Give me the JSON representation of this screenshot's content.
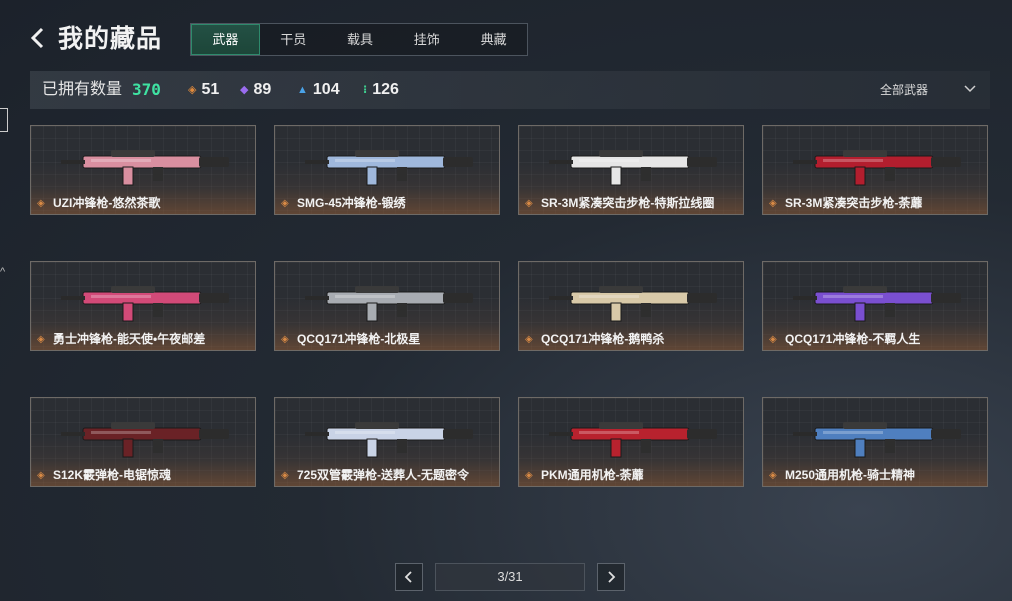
{
  "header": {
    "title": "我的藏品"
  },
  "tabs": [
    {
      "label": "武器",
      "active": true
    },
    {
      "label": "干员",
      "active": false
    },
    {
      "label": "载具",
      "active": false
    },
    {
      "label": "挂饰",
      "active": false
    },
    {
      "label": "典藏",
      "active": false
    }
  ],
  "stats": {
    "owned_label": "已拥有数量",
    "owned_count": "370",
    "tiers": [
      {
        "icon": "orange-diamond-icon",
        "color": "#e08a3c",
        "count": "51"
      },
      {
        "icon": "purple-diamond-icon",
        "color": "#9a6cf0",
        "count": "89"
      },
      {
        "icon": "blue-chevron-icon",
        "color": "#4aa3e8",
        "count": "104"
      },
      {
        "icon": "green-dots-icon",
        "color": "#3fd08f",
        "count": "126"
      }
    ],
    "filter_label": "全部武器"
  },
  "items": [
    {
      "name": "UZI冲锋枪-悠然茶歌",
      "gun_color": "#d98fa0"
    },
    {
      "name": "SMG-45冲锋枪-锻绣",
      "gun_color": "#9fb8dc"
    },
    {
      "name": "SR-3M紧凑突击步枪-特斯拉线圈",
      "gun_color": "#e6e6e6"
    },
    {
      "name": "SR-3M紧凑突击步枪-荼蘼",
      "gun_color": "#b31e2e"
    },
    {
      "name": "勇士冲锋枪-能天使•午夜邮差",
      "gun_color": "#d24a78"
    },
    {
      "name": "QCQ171冲锋枪-北极星",
      "gun_color": "#a8acb2"
    },
    {
      "name": "QCQ171冲锋枪-鹅鸭杀",
      "gun_color": "#d8c9a8"
    },
    {
      "name": "QCQ171冲锋枪-不羁人生",
      "gun_color": "#7a4fd0"
    },
    {
      "name": "S12K霰弹枪-电锯惊魂",
      "gun_color": "#6a2226"
    },
    {
      "name": "725双管霰弹枪-送葬人-无题密令",
      "gun_color": "#c9d3e6"
    },
    {
      "name": "PKM通用机枪-荼蘼",
      "gun_color": "#b8222e"
    },
    {
      "name": "M250通用机枪-骑士精神",
      "gun_color": "#4f7fbf"
    }
  ],
  "pagination": {
    "label": "3/31"
  }
}
